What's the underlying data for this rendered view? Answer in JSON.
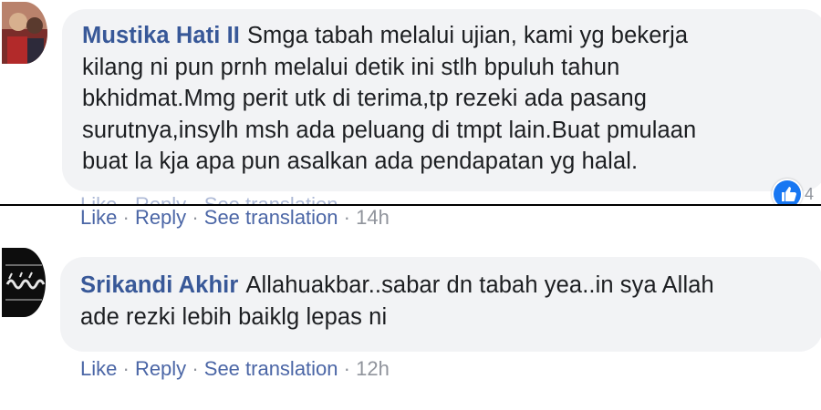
{
  "comments": [
    {
      "author": "Mustika Hati II",
      "lines": [
        "Smga tabah melalui ujian, kami yg bekerja",
        "kilang ni pun prnh melalui detik ini stlh bpuluh tahun",
        "bkhidmat.Mmg perit utk di terima,tp rezeki ada pasang",
        "surutnya,insylh msh ada peluang di tmpt lain.Buat pmulaan",
        "buat la kja apa pun asalkan ada pendapatan yg halal."
      ],
      "actions": {
        "like": "Like",
        "reply": "Reply",
        "translate": "See translation",
        "separator": "·",
        "time": "14h"
      },
      "reaction_count": "4",
      "reaction_icon": "like-thumb-icon"
    },
    {
      "author": "Srikandi Akhir",
      "lines": [
        "Allahuakbar..sabar dn tabah yea..in sya Allah",
        "ade rezki lebih baiklg lepas ni"
      ],
      "actions": {
        "like": "Like",
        "reply": "Reply",
        "translate": "See translation",
        "separator": "·",
        "time": "12h"
      }
    }
  ],
  "colors": {
    "author": "#385898",
    "action_link": "#4b66a6",
    "meta": "#90949c",
    "bubble": "#f2f3f5",
    "reaction": "#1877f2"
  }
}
